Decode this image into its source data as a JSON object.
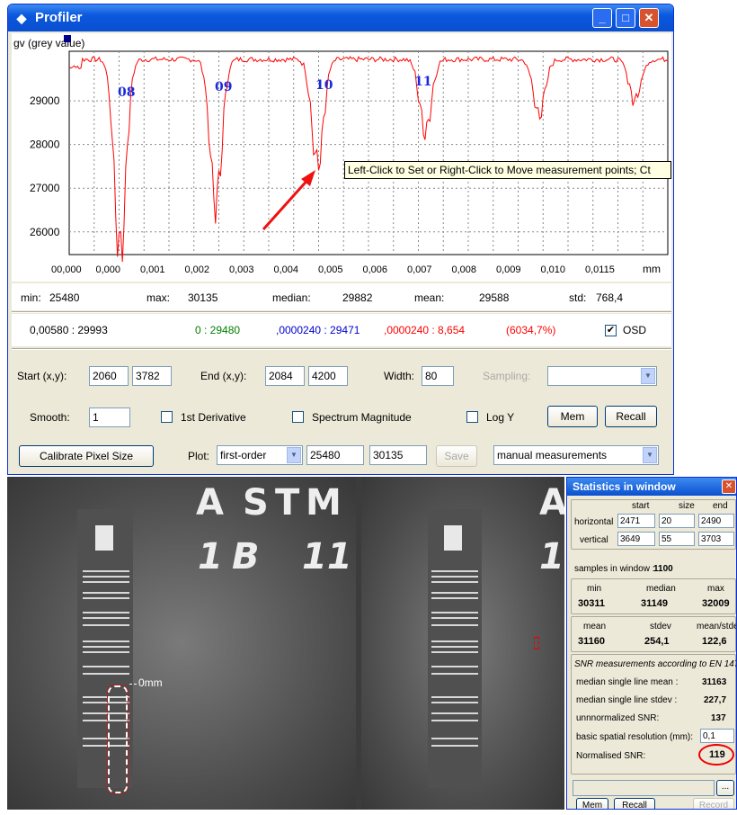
{
  "window": {
    "title": "Profiler",
    "icon": "profiler-icon"
  },
  "plot": {
    "ylabel": "gv (grey value)",
    "xunit": "mm",
    "x_tick_labels": [
      "00,000",
      "0,000",
      "0,001",
      "0,002",
      "0,003",
      "0,004",
      "0,005",
      "0,006",
      "0,007",
      "0,008",
      "0,009",
      "0,010",
      "0,0115"
    ],
    "y_tick_labels": [
      "29000",
      "28000",
      "27000",
      "26000"
    ],
    "markers": [
      "08",
      "09",
      "10",
      "11"
    ],
    "tooltip": "Left-Click to Set or Right-Click to Move measurement points; Ct",
    "color": "#ff0000"
  },
  "chart_data": {
    "type": "line",
    "ylabel": "gv (grey value)",
    "xlabel": "mm",
    "ylim": [
      25480,
      30135
    ],
    "grid": true,
    "dips": [
      {
        "x_frac": 0.085,
        "min": 25520
      },
      {
        "x_frac": 0.245,
        "min": 26650
      },
      {
        "x_frac": 0.415,
        "min": 27550
      },
      {
        "x_frac": 0.595,
        "min": 28300
      },
      {
        "x_frac": 0.785,
        "min": 28700
      },
      {
        "x_frac": 0.945,
        "min": 29020
      }
    ],
    "baseline": 29950
  },
  "stats_row": {
    "min_label": "min:",
    "min": "25480",
    "max_label": "max:",
    "max": "30135",
    "median_label": "median:",
    "median": "29882",
    "mean_label": "mean:",
    "mean": "29588",
    "std_label": "std:",
    "std": "768,4"
  },
  "cursor_row": {
    "pos": "0,00580 : 29993",
    "green": "0 : 29480",
    "blue": ",0000240 : 29471",
    "red": ",0000240 : 8,654",
    "pct": "(6034,7%)",
    "osd_label": "OSD",
    "osd_checked": true
  },
  "controls": {
    "start_label": "Start (x,y):",
    "start_x": "2060",
    "start_y": "3782",
    "end_label": "End (x,y):",
    "end_x": "2084",
    "end_y": "4200",
    "width_label": "Width:",
    "width": "80",
    "sampling_label": "Sampling:",
    "sampling_value": "",
    "smooth_label": "Smooth:",
    "smooth": "1",
    "first_deriv_label": "1st Derivative",
    "spectrum_label": "Spectrum Magnitude",
    "logy_label": "Log Y",
    "mem_label": "Mem",
    "recall_label": "Recall",
    "calibrate_label": "Calibrate Pixel Size",
    "plot_label": "Plot:",
    "plot_value": "first-order",
    "plot_min": "25480",
    "plot_max": "30135",
    "save_label": "Save",
    "mode_value": "manual measurements"
  },
  "xray": {
    "letters_top": [
      "A",
      "S",
      "T",
      "M"
    ],
    "letters_bottom": [
      "1",
      "B",
      "11"
    ],
    "right_letters_top": [
      "A"
    ],
    "right_letters_bottom": [
      "1"
    ],
    "annotation": "0mm"
  },
  "stats_window": {
    "title": "Statistics in window",
    "col_start": "start",
    "col_size": "size",
    "col_end": "end",
    "horizontal_label": "horizontal",
    "h_start": "2471",
    "h_size": "20",
    "h_end": "2490",
    "vertical_label": "vertical",
    "v_start": "3649",
    "v_size": "55",
    "v_end": "3703",
    "samples_label": "samples in window :",
    "samples": "1100",
    "min_label": "min",
    "min": "30311",
    "median_label": "median",
    "median": "31149",
    "max_label": "max",
    "max": "32009",
    "mean_label": "mean",
    "mean": "31160",
    "stdev_label": "stdev",
    "stdev": "254,1",
    "ms_label": "mean/stdev",
    "ms": "122,6",
    "snr_heading": "SNR measurements according to EN 14784",
    "msl_mean_label": "median single line mean :",
    "msl_mean": "31163",
    "msl_std_label": "median single line stdev :",
    "msl_std": "227,7",
    "unnorm_label": "unnnormalized SNR:",
    "unnorm": "137",
    "bsr_label": "basic spatial resolution (mm):",
    "bsr": "0,1",
    "norm_label": "Normalised SNR:",
    "norm": "119",
    "browse_label": "...",
    "mem_label": "Mem",
    "recall_label": "Recall",
    "record_label": "Record"
  }
}
